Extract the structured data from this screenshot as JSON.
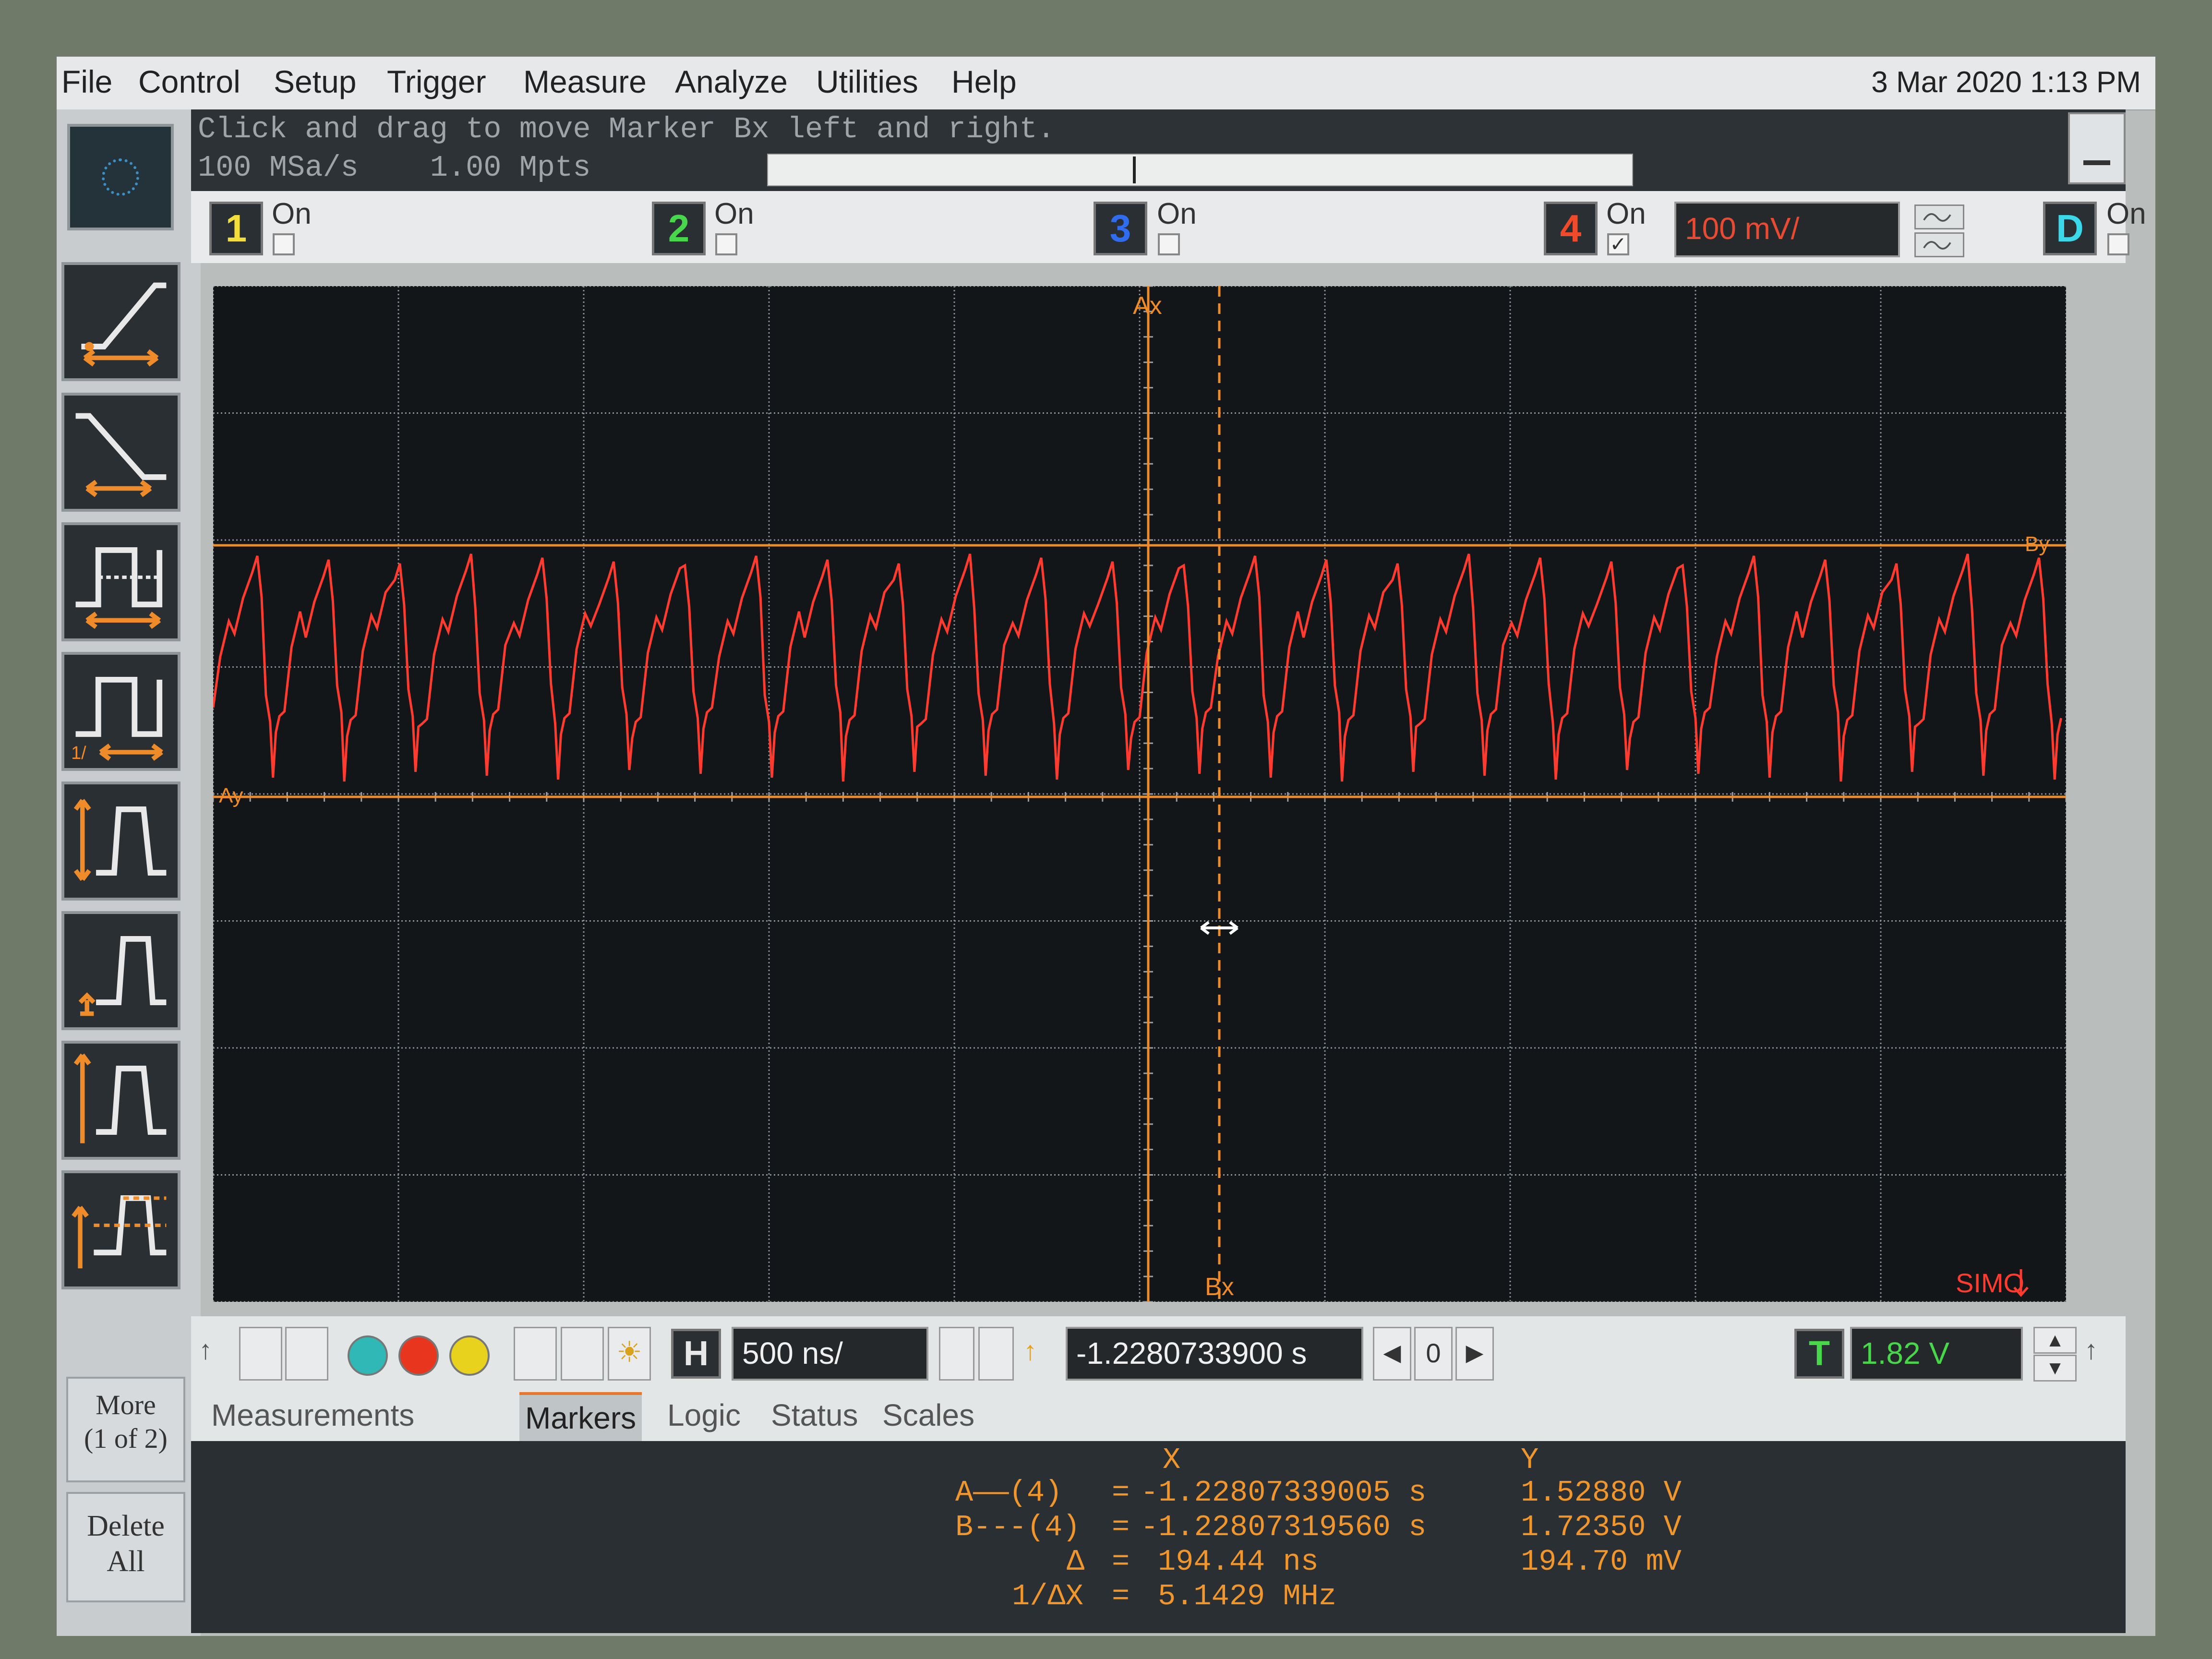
{
  "menu": {
    "items": [
      "File",
      "Control",
      "Setup",
      "Trigger",
      "Measure",
      "Analyze",
      "Utilities",
      "Help"
    ],
    "datetime": "3 Mar 2020  1:13 PM"
  },
  "status": {
    "hint": "Click and drag to move Marker Bx left and right.",
    "sample_rate": "100 MSa/s",
    "memory_depth": "1.00 Mpts"
  },
  "channels": [
    {
      "num": "1",
      "on_label": "On",
      "checked": false,
      "color": "#f2dd3a"
    },
    {
      "num": "2",
      "on_label": "On",
      "checked": false,
      "color": "#48d64a"
    },
    {
      "num": "3",
      "on_label": "On",
      "checked": false,
      "color": "#2f6cf0"
    },
    {
      "num": "4",
      "on_label": "On",
      "checked": true,
      "color": "#f04a2a",
      "scale": "100 mV/"
    },
    {
      "num": "D",
      "on_label": "On",
      "checked": false,
      "color": "#3ad8e8"
    }
  ],
  "display": {
    "marker_ax_label": "Ax",
    "marker_bx_label": "Bx",
    "marker_ay_label": "Ay",
    "marker_by_label": "By",
    "simo_label": "SIMO",
    "trace_color": "#ff3b2f",
    "marker_color": "#f08b2a"
  },
  "controls": {
    "horizontal_label": "H",
    "timebase": "500 ns/",
    "delay": "-1.2280733900 s",
    "delay_ref": "0",
    "trigger_label": "T",
    "trigger_level": "1.82 V"
  },
  "left_toolbar": {
    "more_label": "More\n(1 of 2)",
    "delete_label": "Delete\nAll"
  },
  "tabs": [
    "Measurements",
    "Markers",
    "Logic",
    "Status",
    "Scales"
  ],
  "active_tab": "Markers",
  "readout": {
    "x_header": "X",
    "y_header": "Y",
    "a_label": "A——(4)",
    "a_x": "-1.22807339005 s",
    "a_y": "1.52880 V",
    "b_label": "B---(4)",
    "b_x": "-1.22807319560 s",
    "b_y": "1.72350 V",
    "delta_label": "Δ",
    "delta_x": "194.44 ns",
    "delta_y": "194.70 mV",
    "inv_label": "1/ΔX",
    "inv_x": "5.1429 MHz"
  }
}
